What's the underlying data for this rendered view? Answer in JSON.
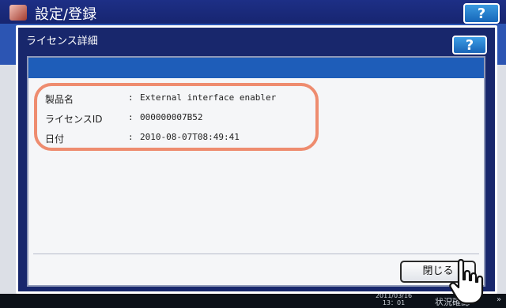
{
  "app": {
    "title": "設定/登録",
    "help_label": "?",
    "datetime_line1": "2011/03/16",
    "datetime_line2": "13：01",
    "status_label": "状況確認",
    "next_glyph": "»"
  },
  "dialog": {
    "title": "ライセンス詳細",
    "help_label": "?",
    "details": [
      {
        "label": "製品名",
        "separator": ":",
        "value": "External interface enabler"
      },
      {
        "label": "ライセンスID",
        "separator": ":",
        "value": "000000007B52"
      },
      {
        "label": "日付",
        "separator": ":",
        "value": "2010-08-07T08:49:41"
      }
    ],
    "close_label": "閉じる"
  }
}
